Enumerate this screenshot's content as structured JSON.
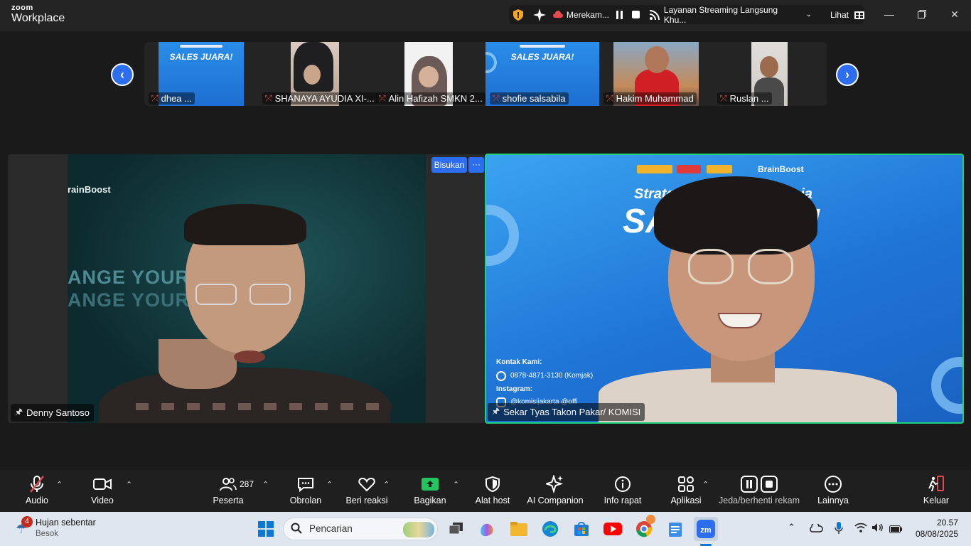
{
  "app": {
    "brand_small": "zoom",
    "brand_name": "Workplace"
  },
  "status_bar": {
    "recording_label": "Merekam...",
    "streaming_label": "Layanan Streaming Langsung Khu...",
    "view_label": "Lihat"
  },
  "thumbnails": [
    {
      "name": "dhea ...",
      "banner_title": "SALES JUARA!"
    },
    {
      "name": "SHANAYA AYUDIA XI-..."
    },
    {
      "name": "Alin Hafizah SMKN 2..."
    },
    {
      "name": "shofie salsabila",
      "banner_title": "SALES JUARA!"
    },
    {
      "name": "Hakim Muhammad"
    },
    {
      "name": "Ruslan ..."
    }
  ],
  "main_left": {
    "name": "Denny Santoso",
    "brand_text": "rainBoost",
    "slogan_line1": "ANGE YOUR L",
    "slogan_line2": "ANGE YOUR L",
    "whisper_label": "Bisukan",
    "more_label": "···"
  },
  "main_right": {
    "name": "Sekar Tyas Takon Pakar/ KOMISI",
    "title_top": "Strategi",
    "title_top2": "asia",
    "title_big": "SAL",
    "title_big2": "A!",
    "contact_heading": "Kontak Kami:",
    "contact_phone": "0878-4871-3130 (Komjak)",
    "instagram_heading": "Instagram:",
    "instagram_handle": "@komisijakarta @offi",
    "brand_text": "BrainBoost"
  },
  "toolbar": {
    "audio": "Audio",
    "video": "Video",
    "participants": "Peserta",
    "participants_count": "287",
    "chat": "Obrolan",
    "reactions": "Beri reaksi",
    "share": "Bagikan",
    "host_tools": "Alat host",
    "ai_companion": "AI Companion",
    "meeting_info": "Info rapat",
    "apps": "Aplikasi",
    "recording_control": "Jeda/berhenti rekam",
    "more": "Lainnya",
    "leave": "Keluar"
  },
  "taskbar": {
    "weather_title": "Hujan sebentar",
    "weather_sub": "Besok",
    "weather_badge": "4",
    "search_placeholder": "Pencarian",
    "time": "20.57",
    "date": "08/08/2025"
  },
  "colors": {
    "accent_blue": "#2d6ef0",
    "active_speaker_border": "#1fd17a",
    "share_green": "#22c55e",
    "leave_red": "#e5484d"
  }
}
